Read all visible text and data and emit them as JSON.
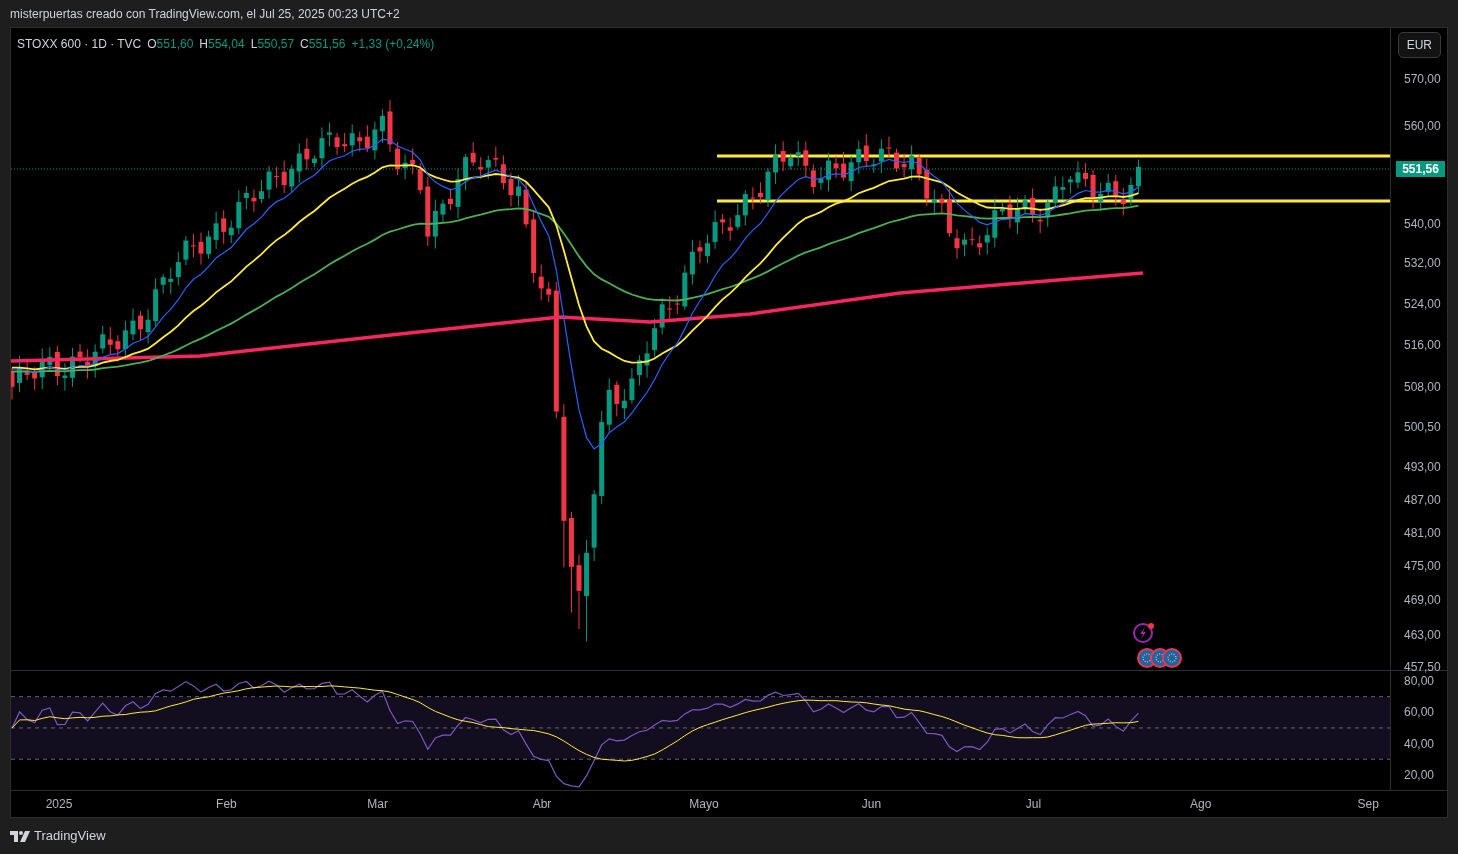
{
  "header": {
    "title": "misterpuertas creado con TradingView.com, el Jul 25, 2025 00:23 UTC+2"
  },
  "legend": {
    "symbol": "STOXX 600 · 1D · TVC",
    "ohlc": [
      {
        "label": "O",
        "value": "551,60"
      },
      {
        "label": "H",
        "value": "554,04"
      },
      {
        "label": "L",
        "value": "550,57"
      },
      {
        "label": "C",
        "value": "551,56"
      }
    ],
    "change": "+1,33 (+0,24%)"
  },
  "currency_button": "EUR",
  "price_axis": {
    "ticks": [
      "570,00",
      "560,00",
      "540,00",
      "532,00",
      "524,00",
      "516,00",
      "508,00",
      "500,50",
      "493,00",
      "487,00",
      "481,00",
      "475,00",
      "469,00",
      "463,00",
      "457,50"
    ],
    "last_price": "551,56"
  },
  "rsi_axis": {
    "ticks": [
      "80,00",
      "60,00",
      "40,00",
      "20,00"
    ]
  },
  "time_axis": {
    "labels": [
      "2025",
      "Feb",
      "Mar",
      "Abr",
      "Mayo",
      "Jun",
      "Jul",
      "Ago",
      "Sep"
    ]
  },
  "footer": {
    "logo_text": "TradingView"
  }
}
